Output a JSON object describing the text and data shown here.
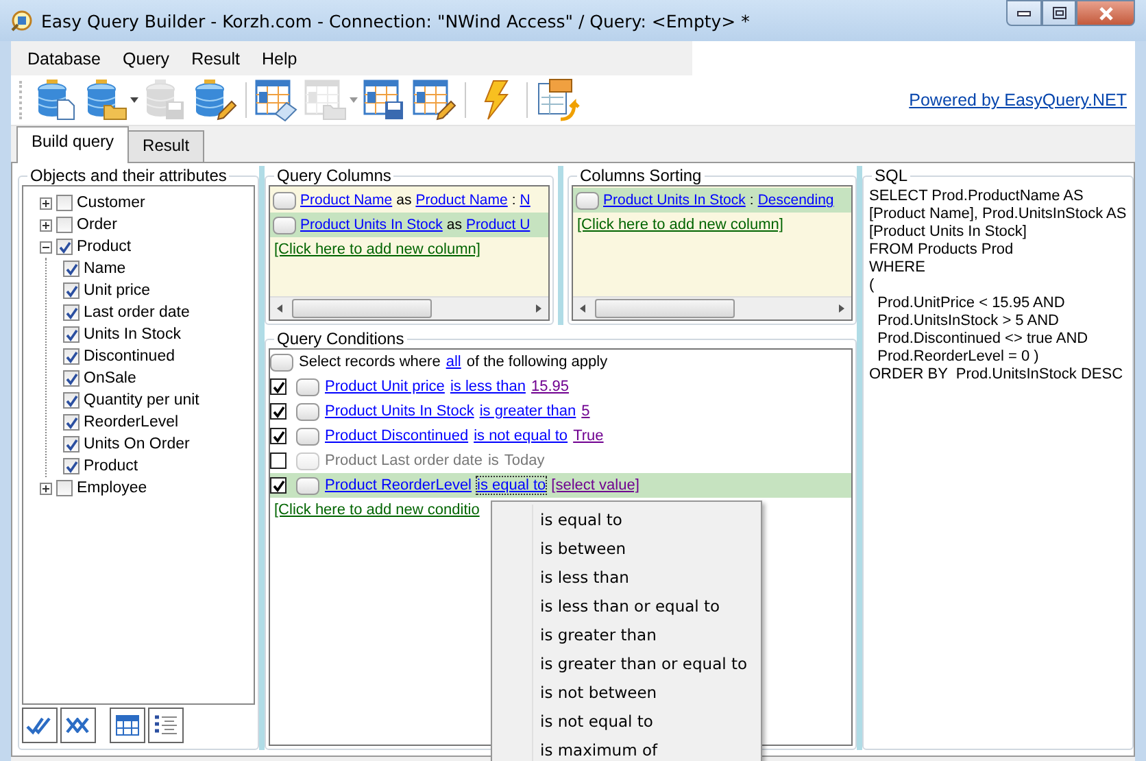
{
  "window": {
    "title": "Easy Query Builder - Korzh.com - Connection: \"NWind Access\" / Query: <Empty> *"
  },
  "menu": [
    "Database",
    "Query",
    "Result",
    "Help"
  ],
  "toolbar": {
    "buttons": [
      {
        "kind": "dbnew",
        "dropdown": false,
        "disabled": false
      },
      {
        "kind": "dbopen",
        "dropdown": true,
        "disabled": false
      },
      {
        "kind": "dbsave",
        "dropdown": false,
        "disabled": true
      },
      {
        "kind": "dbedit",
        "dropdown": false,
        "disabled": false
      },
      {
        "kind": "queryclear",
        "dropdown": false,
        "disabled": false
      },
      {
        "kind": "queryopen",
        "dropdown": true,
        "disabled": true
      },
      {
        "kind": "querysave",
        "dropdown": false,
        "disabled": false
      },
      {
        "kind": "queryedit",
        "dropdown": false,
        "disabled": false
      },
      {
        "kind": "run",
        "dropdown": false,
        "disabled": false
      },
      {
        "kind": "export",
        "dropdown": false,
        "disabled": false
      }
    ],
    "link": "Powered by EasyQuery.NET"
  },
  "tabs": [
    {
      "label": "Build query",
      "selected": true
    },
    {
      "label": "Result",
      "selected": false
    }
  ],
  "objects_panel": {
    "title": "Objects and their attributes",
    "tree": [
      {
        "label": "Customer",
        "checked": false,
        "expanded": false
      },
      {
        "label": "Order",
        "checked": false,
        "expanded": false
      },
      {
        "label": "Product",
        "checked": true,
        "expanded": true,
        "children": [
          {
            "label": "Name",
            "checked": true
          },
          {
            "label": "Unit price",
            "checked": true
          },
          {
            "label": "Last order date",
            "checked": true
          },
          {
            "label": "Units In Stock",
            "checked": true
          },
          {
            "label": "Discontinued",
            "checked": true
          },
          {
            "label": "OnSale",
            "checked": true
          },
          {
            "label": "Quantity per unit",
            "checked": true
          },
          {
            "label": "ReorderLevel",
            "checked": true
          },
          {
            "label": "Units On Order",
            "checked": true
          },
          {
            "label": "Product",
            "checked": true
          }
        ]
      },
      {
        "label": "Employee",
        "checked": false,
        "expanded": false
      }
    ]
  },
  "query_columns": {
    "title": "Query Columns",
    "rows": [
      {
        "attribute": "Product Name",
        "connector": "as",
        "alias": "Product Name",
        "separator": ":",
        "sorting": "N",
        "selected": false
      },
      {
        "attribute": "Product Units In Stock",
        "connector": "as",
        "alias": "Product U",
        "selected": true
      }
    ],
    "add_link": "[Click here to add new column]"
  },
  "columns_sorting": {
    "title": "Columns Sorting",
    "rows": [
      {
        "attribute": "Product Units In Stock",
        "separator": ":",
        "direction": "Descending",
        "selected": true
      }
    ],
    "add_link": "[Click here to add new column]"
  },
  "query_conditions": {
    "title": "Query Conditions",
    "header": {
      "prefix": "Select records where",
      "quantifier": "all",
      "suffix": "of the following apply"
    },
    "rows": [
      {
        "enabled": true,
        "attribute": "Product Unit price",
        "operator": "is less than",
        "value": "15.95",
        "selected": false,
        "focused": false
      },
      {
        "enabled": true,
        "attribute": "Product Units In Stock",
        "operator": "is greater than",
        "value": "5",
        "selected": false,
        "focused": false
      },
      {
        "enabled": true,
        "attribute": "Product Discontinued",
        "operator": "is not equal to",
        "value": "True",
        "selected": false,
        "focused": false
      },
      {
        "enabled": false,
        "attribute": "Product Last order date",
        "operator": "is",
        "value": "Today",
        "selected": false,
        "focused": false
      },
      {
        "enabled": true,
        "attribute": "Product ReorderLevel",
        "operator": "is equal to",
        "value": "[select value]",
        "selected": true,
        "focused": true
      }
    ],
    "add_link": "[Click here to add new conditio",
    "popup_menu": [
      "is equal to",
      "is between",
      "is less than",
      "is less than or equal to",
      "is greater than",
      "is greater than or equal to",
      "is not between",
      "is not equal to",
      "is maximum of"
    ]
  },
  "sql": {
    "title": "SQL",
    "lines": [
      "SELECT Prod.ProductName AS",
      "[Product Name], Prod.UnitsInStock AS",
      "[Product Units In Stock]",
      "FROM Products Prod",
      "WHERE",
      "(",
      "  Prod.UnitPrice < 15.95 AND",
      "  Prod.UnitsInStock > 5 AND",
      "  Prod.Discontinued <> true AND",
      "  Prod.ReorderLevel = 0 )",
      "ORDER BY  Prod.UnitsInStock DESC"
    ]
  }
}
